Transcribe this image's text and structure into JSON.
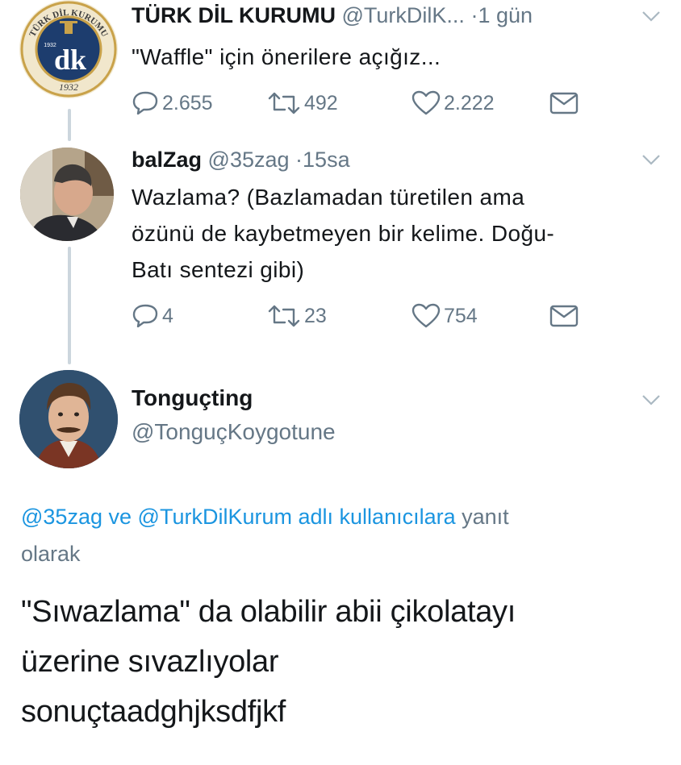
{
  "tweet1": {
    "display_name": "TÜRK DİL KURUMU",
    "handle": "@TurkDilK...",
    "separator": "·",
    "time": "1 gün",
    "text": "\"Waffle\" için önerilere açığız...",
    "avatar": {
      "icon": "tdk-logo",
      "top_text": "TÜRK DİL KURUMU",
      "year": "1932",
      "monogram": "dk",
      "small_year": "1932"
    },
    "actions": {
      "replies": "2.655",
      "retweets": "492",
      "likes": "2.222"
    }
  },
  "tweet2": {
    "display_name": "balZag",
    "handle": "@35zag",
    "separator": "·",
    "time": "15sa",
    "text_lines": [
      "Wazlama? (Bazlamadan türetilen ama",
      "özünü de kaybetmeyen bir kelime. Doğu-",
      "Batı sentezi gibi)"
    ],
    "actions": {
      "replies": "4",
      "retweets": "23",
      "likes": "754"
    }
  },
  "tweet3": {
    "display_name": "Tonguçting",
    "handle": "@TonguçKoygotune",
    "reply_to": {
      "mention1": "@35zag",
      "connector": "ve",
      "mention2": "@TurkDilKurum",
      "link_suffix": "adlı kullanıcılara",
      "suffix_line1": "yanıt",
      "suffix_line2": "olarak"
    },
    "text_lines": [
      "\"Sıwazlama\" da olabilir abii çikolatayı",
      "üzerine sıvazlıyolar",
      "sonuçtaadghjksdfjkf"
    ]
  },
  "colors": {
    "accent": "#1b95e0",
    "secondary": "#657786",
    "thread": "#ccd6dd",
    "text": "#14171a",
    "tdk_navy": "#1d3d6e",
    "tdk_gold": "#c9a24a"
  }
}
